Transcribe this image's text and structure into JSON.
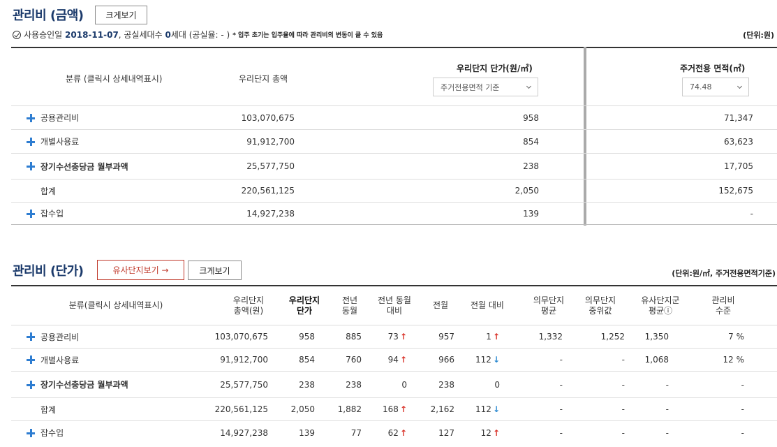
{
  "section1": {
    "title": "관리비 (금액)",
    "enlarge_label": "크게보기",
    "info": {
      "approval_label": "사용승인일",
      "approval_date": "2018-11-07",
      "households_label": ", 공실세대수",
      "households_value": "0",
      "households_suffix": "세대 (공실율: - )",
      "note": "* 입주 초기는 입주율에 따라 관리비의 변동이 클 수 있음"
    },
    "unit": "(단위:원)",
    "headers": {
      "category": "분류 (클릭시 상세내역표시)",
      "total": "우리단지 총액",
      "unit_price": "우리단지 단가(원/㎡)",
      "unit_price_select": "주거전용면적 기준",
      "area": "주거전용 면적(㎡)",
      "area_select": "74.48"
    },
    "rows": [
      {
        "name": "공용관리비",
        "total": "103,070,675",
        "unit": "958",
        "area": "71,347"
      },
      {
        "name": "개별사용료",
        "total": "91,912,700",
        "unit": "854",
        "area": "63,623"
      },
      {
        "name": "장기수선충당금 월부과액",
        "total": "25,577,750",
        "unit": "238",
        "area": "17,705"
      },
      {
        "name": "합계",
        "total": "220,561,125",
        "unit": "2,050",
        "area": "152,675"
      },
      {
        "name": "잡수입",
        "total": "14,927,238",
        "unit": "139",
        "area": "-"
      }
    ]
  },
  "section2": {
    "title": "관리비 (단가)",
    "similar_label": "유사단지보기 →",
    "enlarge_label": "크게보기",
    "unit": "(단위:원/㎡, 주거전용면적기준)",
    "headers": {
      "category": "분류(클릭시 상세내역표시)",
      "total": "우리단지\n총액(원)",
      "unit": "우리단지\n단가",
      "prev_year": "전년\n동월",
      "prev_year_cmp": "전년 동월\n대비",
      "prev_month": "전월",
      "prev_month_cmp": "전월 대비",
      "mandatory_avg": "의무단지\n평균",
      "mandatory_median": "의무단지\n중위값",
      "similar_avg": "유사단지군\n평균ⓘ",
      "level": "관리비\n수준"
    },
    "rows": [
      {
        "name": "공용관리비",
        "total": "103,070,675",
        "unit": "958",
        "prev_year": "885",
        "yoy": "73",
        "yoy_dir": "up",
        "prev_month": "957",
        "mom": "1",
        "mom_dir": "up",
        "m_avg": "1,332",
        "m_median": "1,252",
        "s_avg": "1,350",
        "level": "7 %"
      },
      {
        "name": "개별사용료",
        "total": "91,912,700",
        "unit": "854",
        "prev_year": "760",
        "yoy": "94",
        "yoy_dir": "up",
        "prev_month": "966",
        "mom": "112",
        "mom_dir": "down",
        "m_avg": "-",
        "m_median": "-",
        "s_avg": "1,068",
        "level": "12 %"
      },
      {
        "name": "장기수선충당금 월부과액",
        "total": "25,577,750",
        "unit": "238",
        "prev_year": "238",
        "yoy": "0",
        "yoy_dir": "",
        "prev_month": "238",
        "mom": "0",
        "mom_dir": "",
        "m_avg": "-",
        "m_median": "-",
        "s_avg": "-",
        "level": "-"
      },
      {
        "name": "합계",
        "total": "220,561,125",
        "unit": "2,050",
        "prev_year": "1,882",
        "yoy": "168",
        "yoy_dir": "up",
        "prev_month": "2,162",
        "mom": "112",
        "mom_dir": "down",
        "m_avg": "-",
        "m_median": "-",
        "s_avg": "-",
        "level": "-"
      },
      {
        "name": "잡수입",
        "total": "14,927,238",
        "unit": "139",
        "prev_year": "77",
        "yoy": "62",
        "yoy_dir": "up",
        "prev_month": "127",
        "mom": "12",
        "mom_dir": "up",
        "m_avg": "-",
        "m_median": "-",
        "s_avg": "-",
        "level": "-"
      }
    ]
  },
  "arrows": {
    "up": "↑",
    "down": "↓"
  },
  "colors": {
    "title": "#1b3a6b",
    "plus": "#2e7dd1",
    "up": "#d9342b",
    "down": "#2e8bd1",
    "similar_btn": "#c0392b"
  }
}
